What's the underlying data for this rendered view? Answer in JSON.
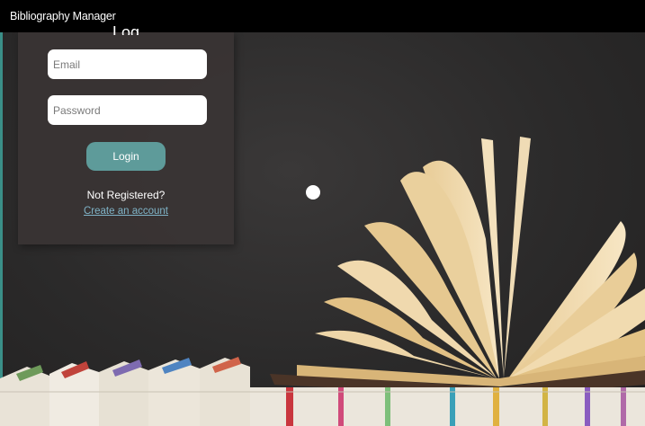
{
  "app": {
    "title": "Bibliography Manager"
  },
  "login": {
    "title_partial": "Log",
    "email_placeholder": "Email",
    "password_placeholder": "Password",
    "login_label": "Login",
    "not_registered": "Not Registered?",
    "create_account": "Create an account"
  },
  "colors": {
    "topbar": "#000000",
    "background": "#2b2a2a",
    "panel": "#3a3434",
    "button": "#5e9b9a",
    "link": "#7fb3c7"
  },
  "decorations": {
    "background_image": "open-book-and-book-spines-photo",
    "cursor": "cursor-dot-icon"
  }
}
